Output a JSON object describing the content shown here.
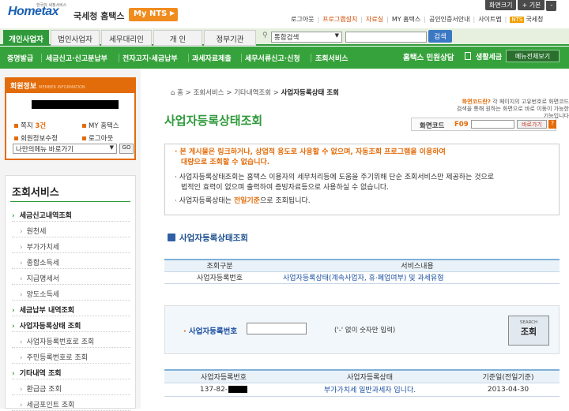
{
  "header": {
    "logo_text": "Hometax",
    "logo_tagline": "한국의 세정서비스",
    "org_name": "국세청 홈택스",
    "mynts_label": "My NTS",
    "top_buttons": [
      "화면크기",
      "+ 기본",
      "-"
    ],
    "top_links": [
      "로그아웃",
      "프로그램설치",
      "자료실",
      "MY 홈택스",
      "공인인증서안내",
      "사이트맵",
      "국세청"
    ],
    "nts_badge": "NTS"
  },
  "nav": {
    "tabs": [
      "개인사업자",
      "법인사업자",
      "세무대리인",
      "개 인",
      "정부기관"
    ],
    "active_tab": "개인사업자",
    "search_select": "통합검색",
    "search_value": "",
    "search_button": "검색"
  },
  "menubar": {
    "items": [
      "증명발급",
      "세금신고·신고분납부",
      "전자고지·세금납부",
      "과세자료제출",
      "세무서류신고·신청",
      "조회서비스"
    ],
    "hometax_center": "홈택스 민원상담",
    "life_tax": "생활세금",
    "menu_see": "메뉴전체보기"
  },
  "member": {
    "title": "회원정보",
    "subtitle": "MEMBER INFORMATION",
    "note_label": "쪽지",
    "note_count": "3건",
    "my_hometax": "MY 홈택스",
    "edit_info": "회원정보수정",
    "logout": "로그아웃",
    "quick_select": "나만의메뉴 바로가기",
    "go": "GO"
  },
  "sidebar": {
    "title": "조회서비스",
    "items": [
      {
        "label": "세금신고내역조회",
        "type": "cat"
      },
      {
        "label": "원천세",
        "type": "sub"
      },
      {
        "label": "부가가치세",
        "type": "sub"
      },
      {
        "label": "종합소득세",
        "type": "sub"
      },
      {
        "label": "지급명세서",
        "type": "sub"
      },
      {
        "label": "양도소득세",
        "type": "sub"
      },
      {
        "label": "세금납부 내역조회",
        "type": "cat"
      },
      {
        "label": "사업자등록상태 조회",
        "type": "cat"
      },
      {
        "label": "사업자등록번호로 조회",
        "type": "sub"
      },
      {
        "label": "주민등록번호로 조회",
        "type": "sub"
      },
      {
        "label": "기타내역 조회",
        "type": "cat"
      },
      {
        "label": "환급금 조회",
        "type": "sub"
      },
      {
        "label": "세금포인트 조회",
        "type": "sub"
      }
    ]
  },
  "breadcrumb": [
    "홈",
    "조회서비스",
    "기타내역조회",
    "사업자등록상태 조회"
  ],
  "page": {
    "title": "사업자등록상태조회",
    "help_line1_hl": "화면코드란?",
    "help_line1": "각 페이지의 고유번호로 화면코드",
    "help_line2": "검색을 통해 원하는 화면으로 바로 이동이 가능한 기능입니다",
    "code_label": "화면코드",
    "code_value": "F09",
    "code_button": "바로가기",
    "code_q": "?"
  },
  "notice": {
    "warn1": "· 본 게시물은 링크하거나, 상업적 용도로 사용할 수 없으며, 자동조회 프로그램을 이용하여",
    "warn2": "대량으로 조회할 수 없습니다.",
    "info1": "· 사업자등록상태조회는 홈택스 이용자의 세무처리등에 도움을 주기위해 단순 조회서비스만 제공하는 것으로",
    "info2": "법적인 효력이 없으며 출력하여 증빙자료등으로 사용하실 수 없습니다.",
    "info3_pre": "· 사업자등록상태는 ",
    "info3_hl": "전일기준",
    "info3_post": "으로 조회됩니다."
  },
  "section": {
    "title": "사업자등록상태조회",
    "table1_headers": [
      "조회구분",
      "서비스내용"
    ],
    "table1_row": [
      "사업자등록번호",
      "사업자등록상태(계속사업자, 휴·폐업여부) 및 과세유형"
    ]
  },
  "form": {
    "label": "사업자등록번호",
    "asterisk": "·",
    "input_value": "",
    "hint": "('-' 없이 숫자만 입력)",
    "search_en": "SEARCH",
    "search_ko": "조회"
  },
  "result": {
    "headers": [
      "사업자등록번호",
      "사업자등록상태",
      "기준일(전일기준)"
    ],
    "row": {
      "number_prefix": "137-82-",
      "status": "부가가치세 일반과세자 입니다.",
      "date": "2013-04-30"
    }
  },
  "colors": {
    "accent_green": "#2f9a3a",
    "orange": "#e36c0a",
    "link_blue": "#1a4fa0"
  }
}
